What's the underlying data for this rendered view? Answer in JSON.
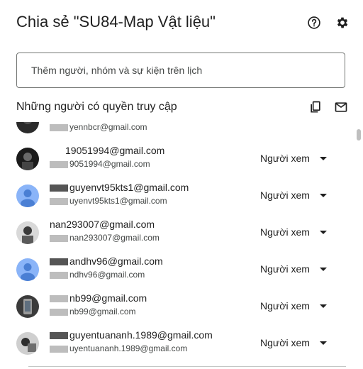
{
  "dialog": {
    "title": "Chia sẻ \"SU84-Map Vật liệu\"",
    "icons": {
      "help": "help-circle-icon",
      "settings": "gear-icon"
    }
  },
  "add_people": {
    "placeholder": "Thêm người, nhóm và sự kiện trên lịch"
  },
  "access_section": {
    "title": "Những người có quyền truy cập",
    "icons": {
      "copy": "copy-icon",
      "mail": "mail-icon"
    }
  },
  "people": [
    {
      "email_main": "",
      "email_sub": "yennbcr@gmail.com",
      "role": "",
      "avatar": "photo-dark"
    },
    {
      "email_main": "19051994@gmail.com",
      "email_sub": "9051994@gmail.com",
      "role": "Người xem",
      "avatar": "photo-dark"
    },
    {
      "email_main": "guyenvt95kts1@gmail.com",
      "email_sub": "uyenvt95kts1@gmail.com",
      "role": "Người xem",
      "avatar": "default"
    },
    {
      "email_main": "nan293007@gmail.com",
      "email_sub": "nan293007@gmail.com",
      "role": "Người xem",
      "avatar": "photo-gray"
    },
    {
      "email_main": "andhv96@gmail.com",
      "email_sub": "ndhv96@gmail.com",
      "role": "Người xem",
      "avatar": "default"
    },
    {
      "email_main": "nb99@gmail.com",
      "email_sub": "nb99@gmail.com",
      "role": "Người xem",
      "avatar": "photo-phone"
    },
    {
      "email_main": "guyentuananh.1989@gmail.com",
      "email_sub": "uyentuananh.1989@gmail.com",
      "role": "Người xem",
      "avatar": "photo-gray"
    }
  ],
  "colors": {
    "default_avatar": "#8ab4f8",
    "default_avatar_person": "#4a7fd4",
    "border": "#747775"
  }
}
